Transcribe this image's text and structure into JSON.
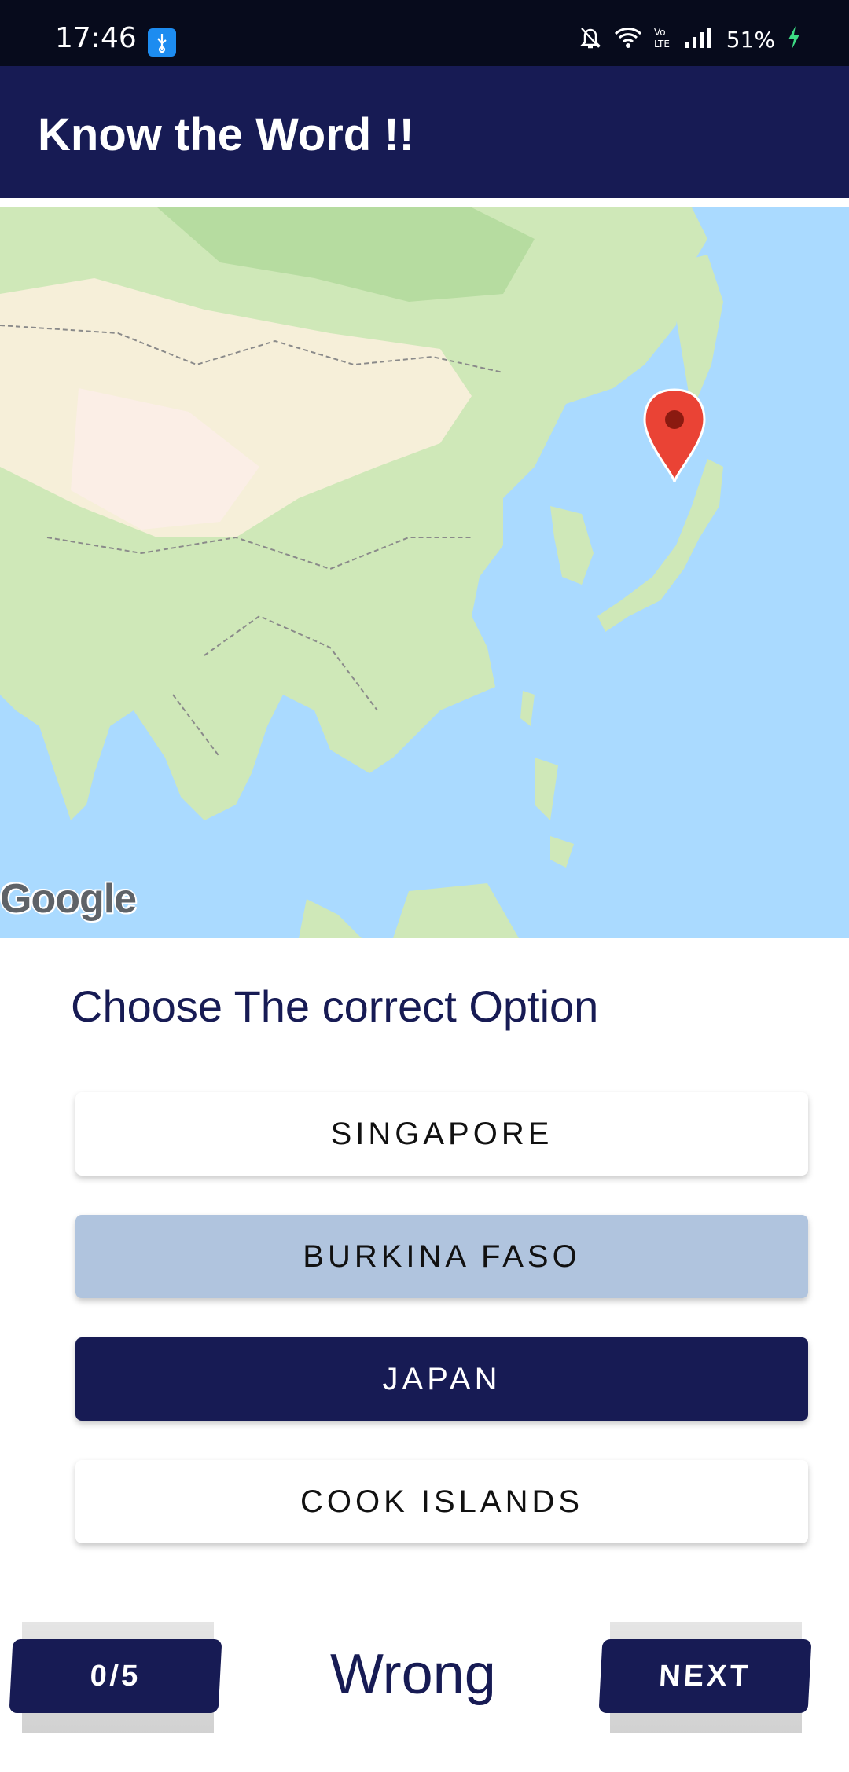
{
  "status_bar": {
    "time": "17:46",
    "battery": "51%",
    "icons": [
      "usb-icon",
      "mute-bell-icon",
      "wifi-icon",
      "volte-icon",
      "signal-icon",
      "charging-icon"
    ]
  },
  "app_bar": {
    "title": "Know the Word !!"
  },
  "map": {
    "logo_text": "Google",
    "marker_icon": "location-pin-icon",
    "colors": {
      "water": "#aadaff",
      "land": "#cfe8b8",
      "marker": "#ea4335"
    }
  },
  "quiz": {
    "question": "Choose The correct Option",
    "options": [
      {
        "label": "SINGAPORE",
        "state": "default"
      },
      {
        "label": "BURKINA FASO",
        "state": "selected-wrong"
      },
      {
        "label": "JAPAN",
        "state": "correct"
      },
      {
        "label": "COOK ISLANDS",
        "state": "default"
      }
    ]
  },
  "footer": {
    "score": "0/5",
    "result": "Wrong",
    "next_label": "NEXT"
  },
  "colors": {
    "primary": "#171b54",
    "wrong_option": "#b0c4de",
    "status_bar": "#070b1c"
  }
}
